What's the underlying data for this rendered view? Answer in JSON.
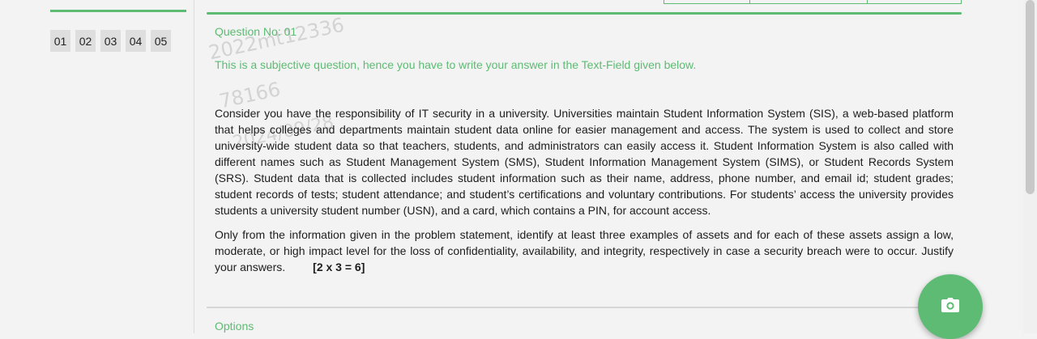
{
  "question_nav": {
    "items": [
      "01",
      "02",
      "03",
      "04",
      "05"
    ]
  },
  "question": {
    "number_label": "Question No: 01",
    "notice": "This is a subjective question, hence you have to write your answer in the Text-Field given below.",
    "paragraph1": "Consider you have the responsibility of IT security in a university. Universities maintain Student Information System (SIS), a web-based platform that helps colleges and departments maintain student data online for easier management and access. The system is used to collect and store university-wide student data so that teachers, students, and administrators can easily access it. Student Information System is also called with different names such as Student Management System (SMS), Student Information Management System (SIMS), or Student Records System (SRS). Student data that is collected includes student information such as their name, address, phone number, and email id; student grades; student records of tests; student attendance; and student’s certifications and voluntary contributions. For students’ access the university provides students a university student number (USN), and a card, which contains a PIN, for account access.",
    "paragraph2": "Only from the information given in the problem statement, identify at least three examples of assets and for each of these assets assign a low, moderate, or high impact level for the loss of confidentiality, availability, and integrity, respectively in case a security breach were to occur.  Justify your answers.",
    "marks": "[2 x 3 = 6]"
  },
  "watermark": {
    "line1": "2022mt12336",
    "line2": "78166",
    "line3": "2024/09/28"
  },
  "options": {
    "label": "Options"
  },
  "camera_button": {
    "icon": "camera-icon"
  },
  "colors": {
    "accent": "#5dbb73",
    "background": "#f3f3f3",
    "nav_item_bg": "#dedede"
  }
}
